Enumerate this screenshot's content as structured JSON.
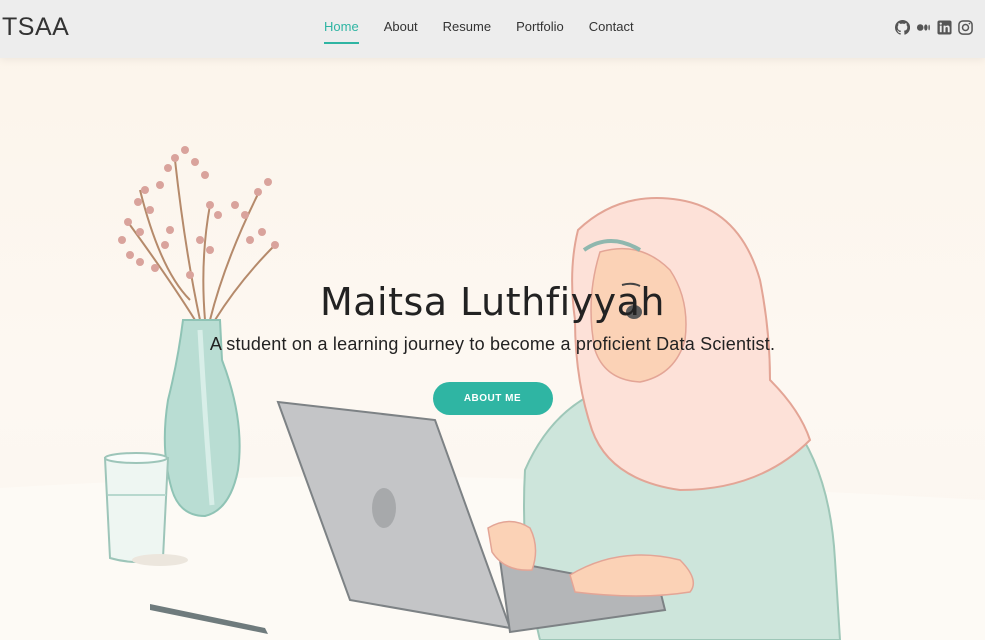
{
  "brand": {
    "logo": "TSAA"
  },
  "nav": {
    "items": [
      {
        "label": "Home",
        "active": true
      },
      {
        "label": "About",
        "active": false
      },
      {
        "label": "Resume",
        "active": false
      },
      {
        "label": "Portfolio",
        "active": false
      },
      {
        "label": "Contact",
        "active": false
      }
    ]
  },
  "social": {
    "icons": [
      "github-icon",
      "medium-icon",
      "linkedin-icon",
      "instagram-icon"
    ]
  },
  "hero": {
    "title": "Maitsa Luthfiyyah",
    "subtitle": "A student on a learning journey to become a proficient Data Scientist.",
    "button_label": "ABOUT ME"
  },
  "colors": {
    "accent": "#2fb5a3",
    "nav_background": "#ececec",
    "hero_background": "#fcf4ea",
    "text": "#222222"
  }
}
